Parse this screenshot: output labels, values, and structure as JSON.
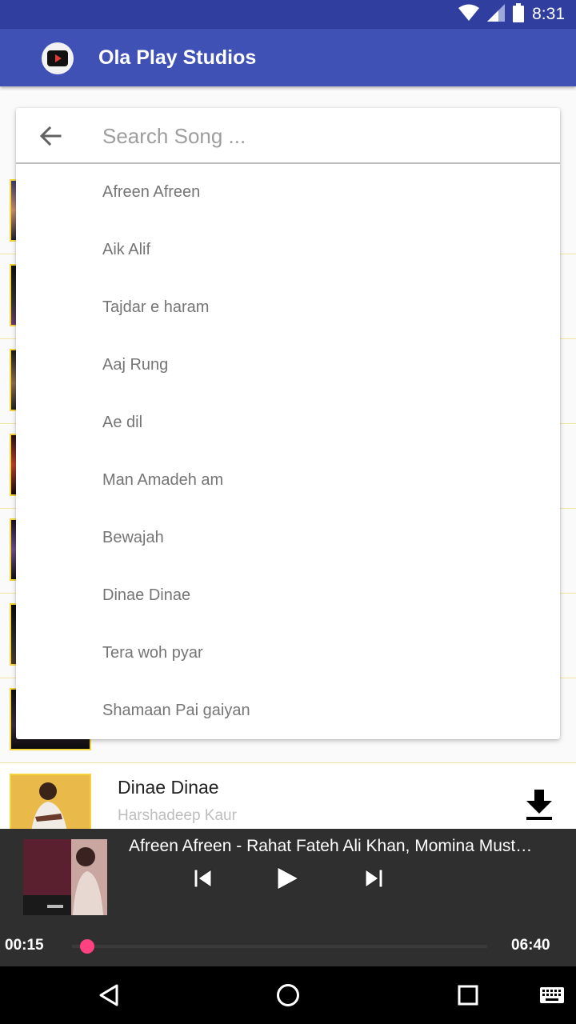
{
  "status_bar": {
    "time": "8:31"
  },
  "app_bar": {
    "title": "Ola Play Studios"
  },
  "search": {
    "placeholder": "Search Song ...",
    "value": "",
    "suggestions": [
      "Afreen Afreen",
      "Aik Alif",
      "Tajdar e haram",
      "Aaj Rung",
      "Ae dil",
      "Man Amadeh am",
      "Bewajah",
      "Dinae Dinae",
      "Tera woh pyar",
      "Shamaan Pai gaiyan"
    ]
  },
  "visible_song": {
    "title": "Dinae Dinae",
    "artist": "Harshadeep Kaur"
  },
  "player": {
    "now_playing": "Afreen Afreen - Rahat Fateh Ali Khan, Momina Must…",
    "elapsed": "00:15",
    "duration": "06:40",
    "progress_fraction": 0.0375
  },
  "colors": {
    "status_bar": "#303f9f",
    "app_bar": "#3f51b5",
    "seek_thumb": "#ff4081",
    "thumb_border": "#f3d43d"
  },
  "icons": [
    "wifi-icon",
    "signal-icon",
    "battery-icon",
    "back-arrow-icon",
    "download-icon",
    "skip-previous-icon",
    "play-icon",
    "skip-next-icon",
    "nav-back-icon",
    "nav-home-icon",
    "nav-recents-icon",
    "keyboard-icon"
  ]
}
